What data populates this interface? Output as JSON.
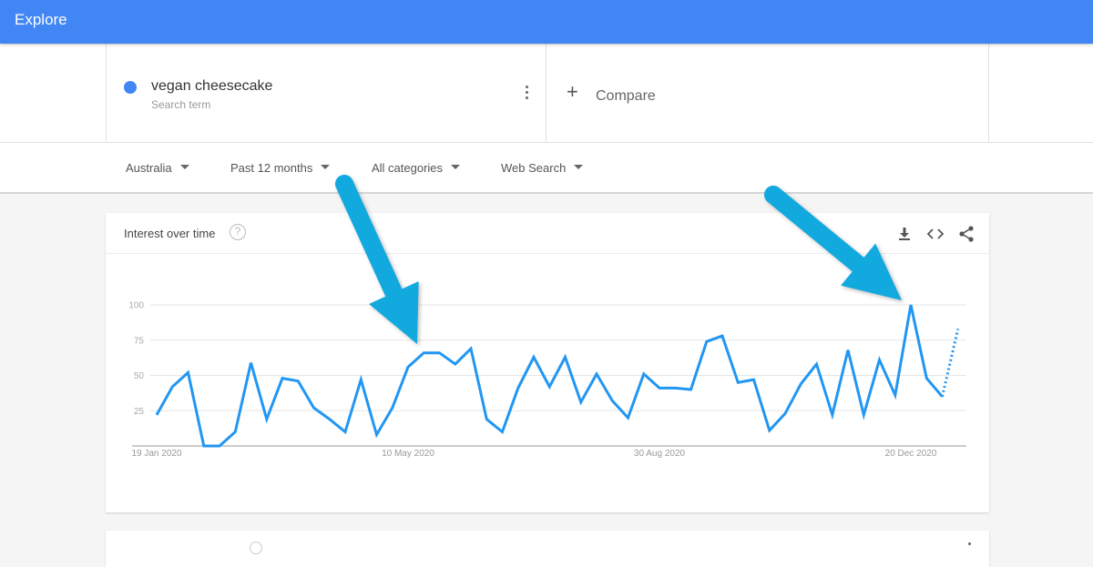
{
  "app": {
    "title": "Explore"
  },
  "search_term": {
    "name": "vegan cheesecake",
    "sub_label": "Search term",
    "dot_color": "#4285f4",
    "menu_icon": "more-vert-icon"
  },
  "compare": {
    "label": "Compare",
    "icon": "plus-icon"
  },
  "filters": [
    {
      "label": "Australia"
    },
    {
      "label": "Past 12 months"
    },
    {
      "label": "All categories"
    },
    {
      "label": "Web Search"
    }
  ],
  "card": {
    "title": "Interest over time",
    "help_icon": "?",
    "tools": [
      "download-icon",
      "embed-code-icon",
      "share-icon"
    ]
  },
  "annotations": {
    "arrow_color": "#12a9df",
    "arrows": [
      {
        "points_to": "10 May 2020 plateau"
      },
      {
        "points_to": "20 Dec 2020 peak"
      }
    ]
  },
  "chart_data": {
    "type": "line",
    "title": "Interest over time",
    "xlabel": "",
    "ylabel": "",
    "ylim": [
      0,
      100
    ],
    "yticks": [
      25,
      50,
      75,
      100
    ],
    "grid": true,
    "line_color": "#2196f3",
    "xtick_labels": [
      {
        "label": "19 Jan 2020",
        "index": 0
      },
      {
        "label": "10 May 2020",
        "index": 16
      },
      {
        "label": "30 Aug 2020",
        "index": 32
      },
      {
        "label": "20 Dec 2020",
        "index": 48
      }
    ],
    "series": [
      {
        "name": "vegan cheesecake",
        "values": [
          22,
          42,
          52,
          0,
          0,
          10,
          59,
          19,
          48,
          46,
          27,
          19,
          10,
          47,
          8,
          27,
          56,
          66,
          66,
          58,
          69,
          19,
          10,
          41,
          63,
          42,
          63,
          31,
          51,
          32,
          20,
          51,
          41,
          41,
          40,
          74,
          78,
          45,
          47,
          11,
          23,
          44,
          58,
          22,
          68,
          22,
          61,
          36,
          100,
          48,
          35,
          83
        ],
        "partial_last_point": true
      }
    ]
  },
  "second_card": {
    "help_icon": "?"
  }
}
